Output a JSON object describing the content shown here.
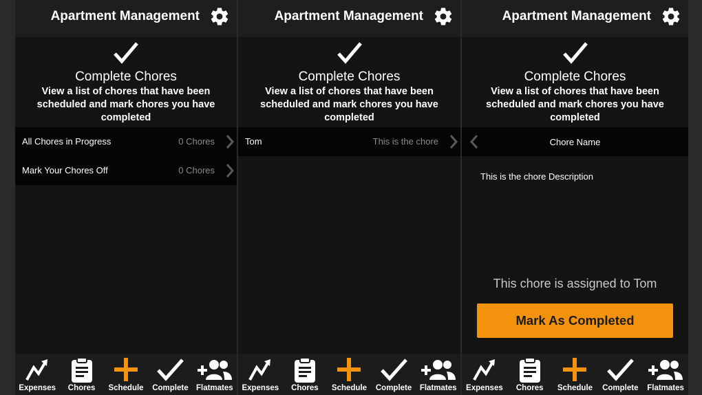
{
  "app_title": "Apartment Management",
  "hero": {
    "title": "Complete Chores",
    "description": "View a list of chores that have been scheduled and mark chores you have completed"
  },
  "tabs": [
    {
      "label": "Expenses",
      "icon": "trend-up-icon"
    },
    {
      "label": "Chores",
      "icon": "clipboard-icon"
    },
    {
      "label": "Schedule",
      "icon": "plus-icon"
    },
    {
      "label": "Complete",
      "icon": "checkmark-icon"
    },
    {
      "label": "Flatmates",
      "icon": "add-user-icon"
    }
  ],
  "screen1": {
    "rows": [
      {
        "label": "All Chores in Progress",
        "value": "0 Chores"
      },
      {
        "label": "Mark Your Chores Off",
        "value": "0 Chores"
      }
    ]
  },
  "screen2": {
    "rows": [
      {
        "label": "Tom",
        "value": "This is the chore"
      }
    ]
  },
  "screen3": {
    "chore_name": "Chore Name",
    "description": "This is the chore Description",
    "assigned_text": "This chore is assigned to Tom",
    "button_label": "Mark As Completed"
  },
  "colors": {
    "accent": "#f2920d",
    "background": "#141414",
    "topbar": "#1e1e1e",
    "row": "#050505",
    "tabbar": "#1c1c1c"
  }
}
